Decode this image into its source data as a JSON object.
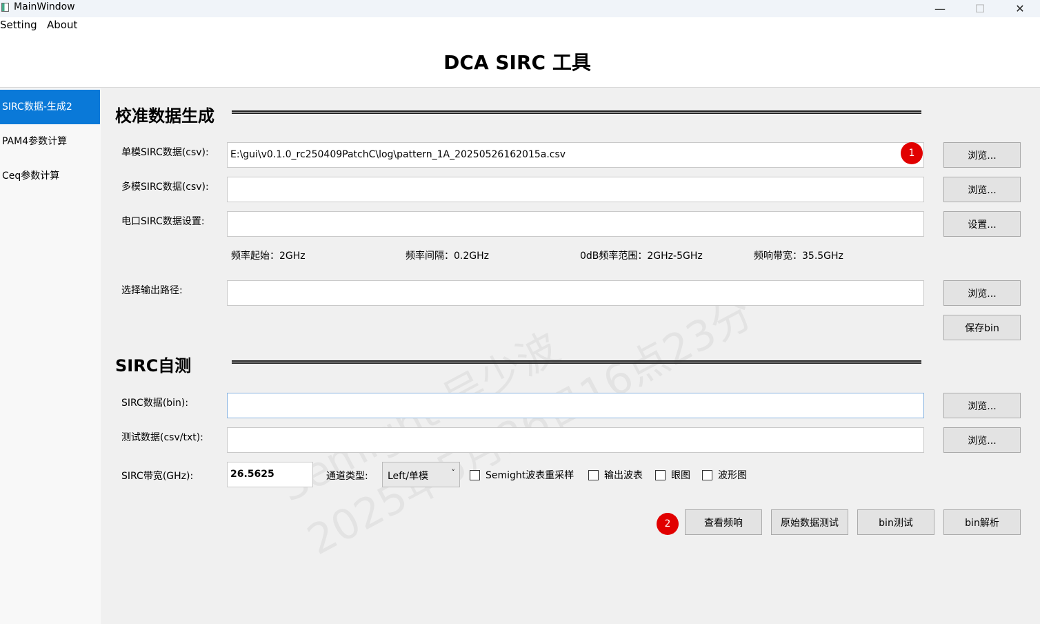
{
  "window": {
    "title": "MainWindow",
    "minimize": "—",
    "maximize": "☐",
    "close": "✕"
  },
  "menu": {
    "setting": "Setting",
    "about": "About"
  },
  "header": {
    "title": "DCA SIRC 工具"
  },
  "sidebar": {
    "items": [
      {
        "label": "SIRC数据-生成2",
        "active": true
      },
      {
        "label": "PAM4参数计算",
        "active": false
      },
      {
        "label": "Ceq参数计算",
        "active": false
      }
    ]
  },
  "calib": {
    "title": "校准数据生成",
    "single_label": "单模SIRC数据(csv):",
    "single_value": "E:\\gui\\v0.1.0_rc250409PatchC\\log\\pattern_1A_20250526162015a.csv",
    "multi_label": "多模SIRC数据(csv):",
    "multi_value": "",
    "elec_label": "电口SIRC数据设置:",
    "elec_value": "",
    "freq_start": "频率起始：2GHz",
    "freq_step": "频率间隔：0.2GHz",
    "freq_range": "0dB频率范围：2GHz-5GHz",
    "bandwidth": "频响带宽：35.5GHz",
    "output_label": "选择输出路径:",
    "output_value": "",
    "browse": "浏览...",
    "settings": "设置...",
    "save_bin": "保存bin"
  },
  "selftest": {
    "title": "SIRC自测",
    "bin_label": "SIRC数据(bin):",
    "bin_value": "",
    "test_label": "测试数据(csv/txt):",
    "test_value": "",
    "bw_label": "SIRC带宽(GHz):",
    "bw_value": "26.5625",
    "channel_label": "通道类型:",
    "channel_value": "Left/单模",
    "check_resample": "Semight波表重采样",
    "check_output": "输出波表",
    "check_eye": "眼图",
    "check_wave": "波形图",
    "btn_freq": "查看频响",
    "btn_raw": "原始数据测试",
    "btn_bin": "bin测试",
    "btn_parse": "bin解析"
  },
  "badges": {
    "one": "1",
    "two": "2"
  },
  "watermark": {
    "line1": "Semight 吴少波",
    "line2": "2025年5月26日16点23分"
  }
}
